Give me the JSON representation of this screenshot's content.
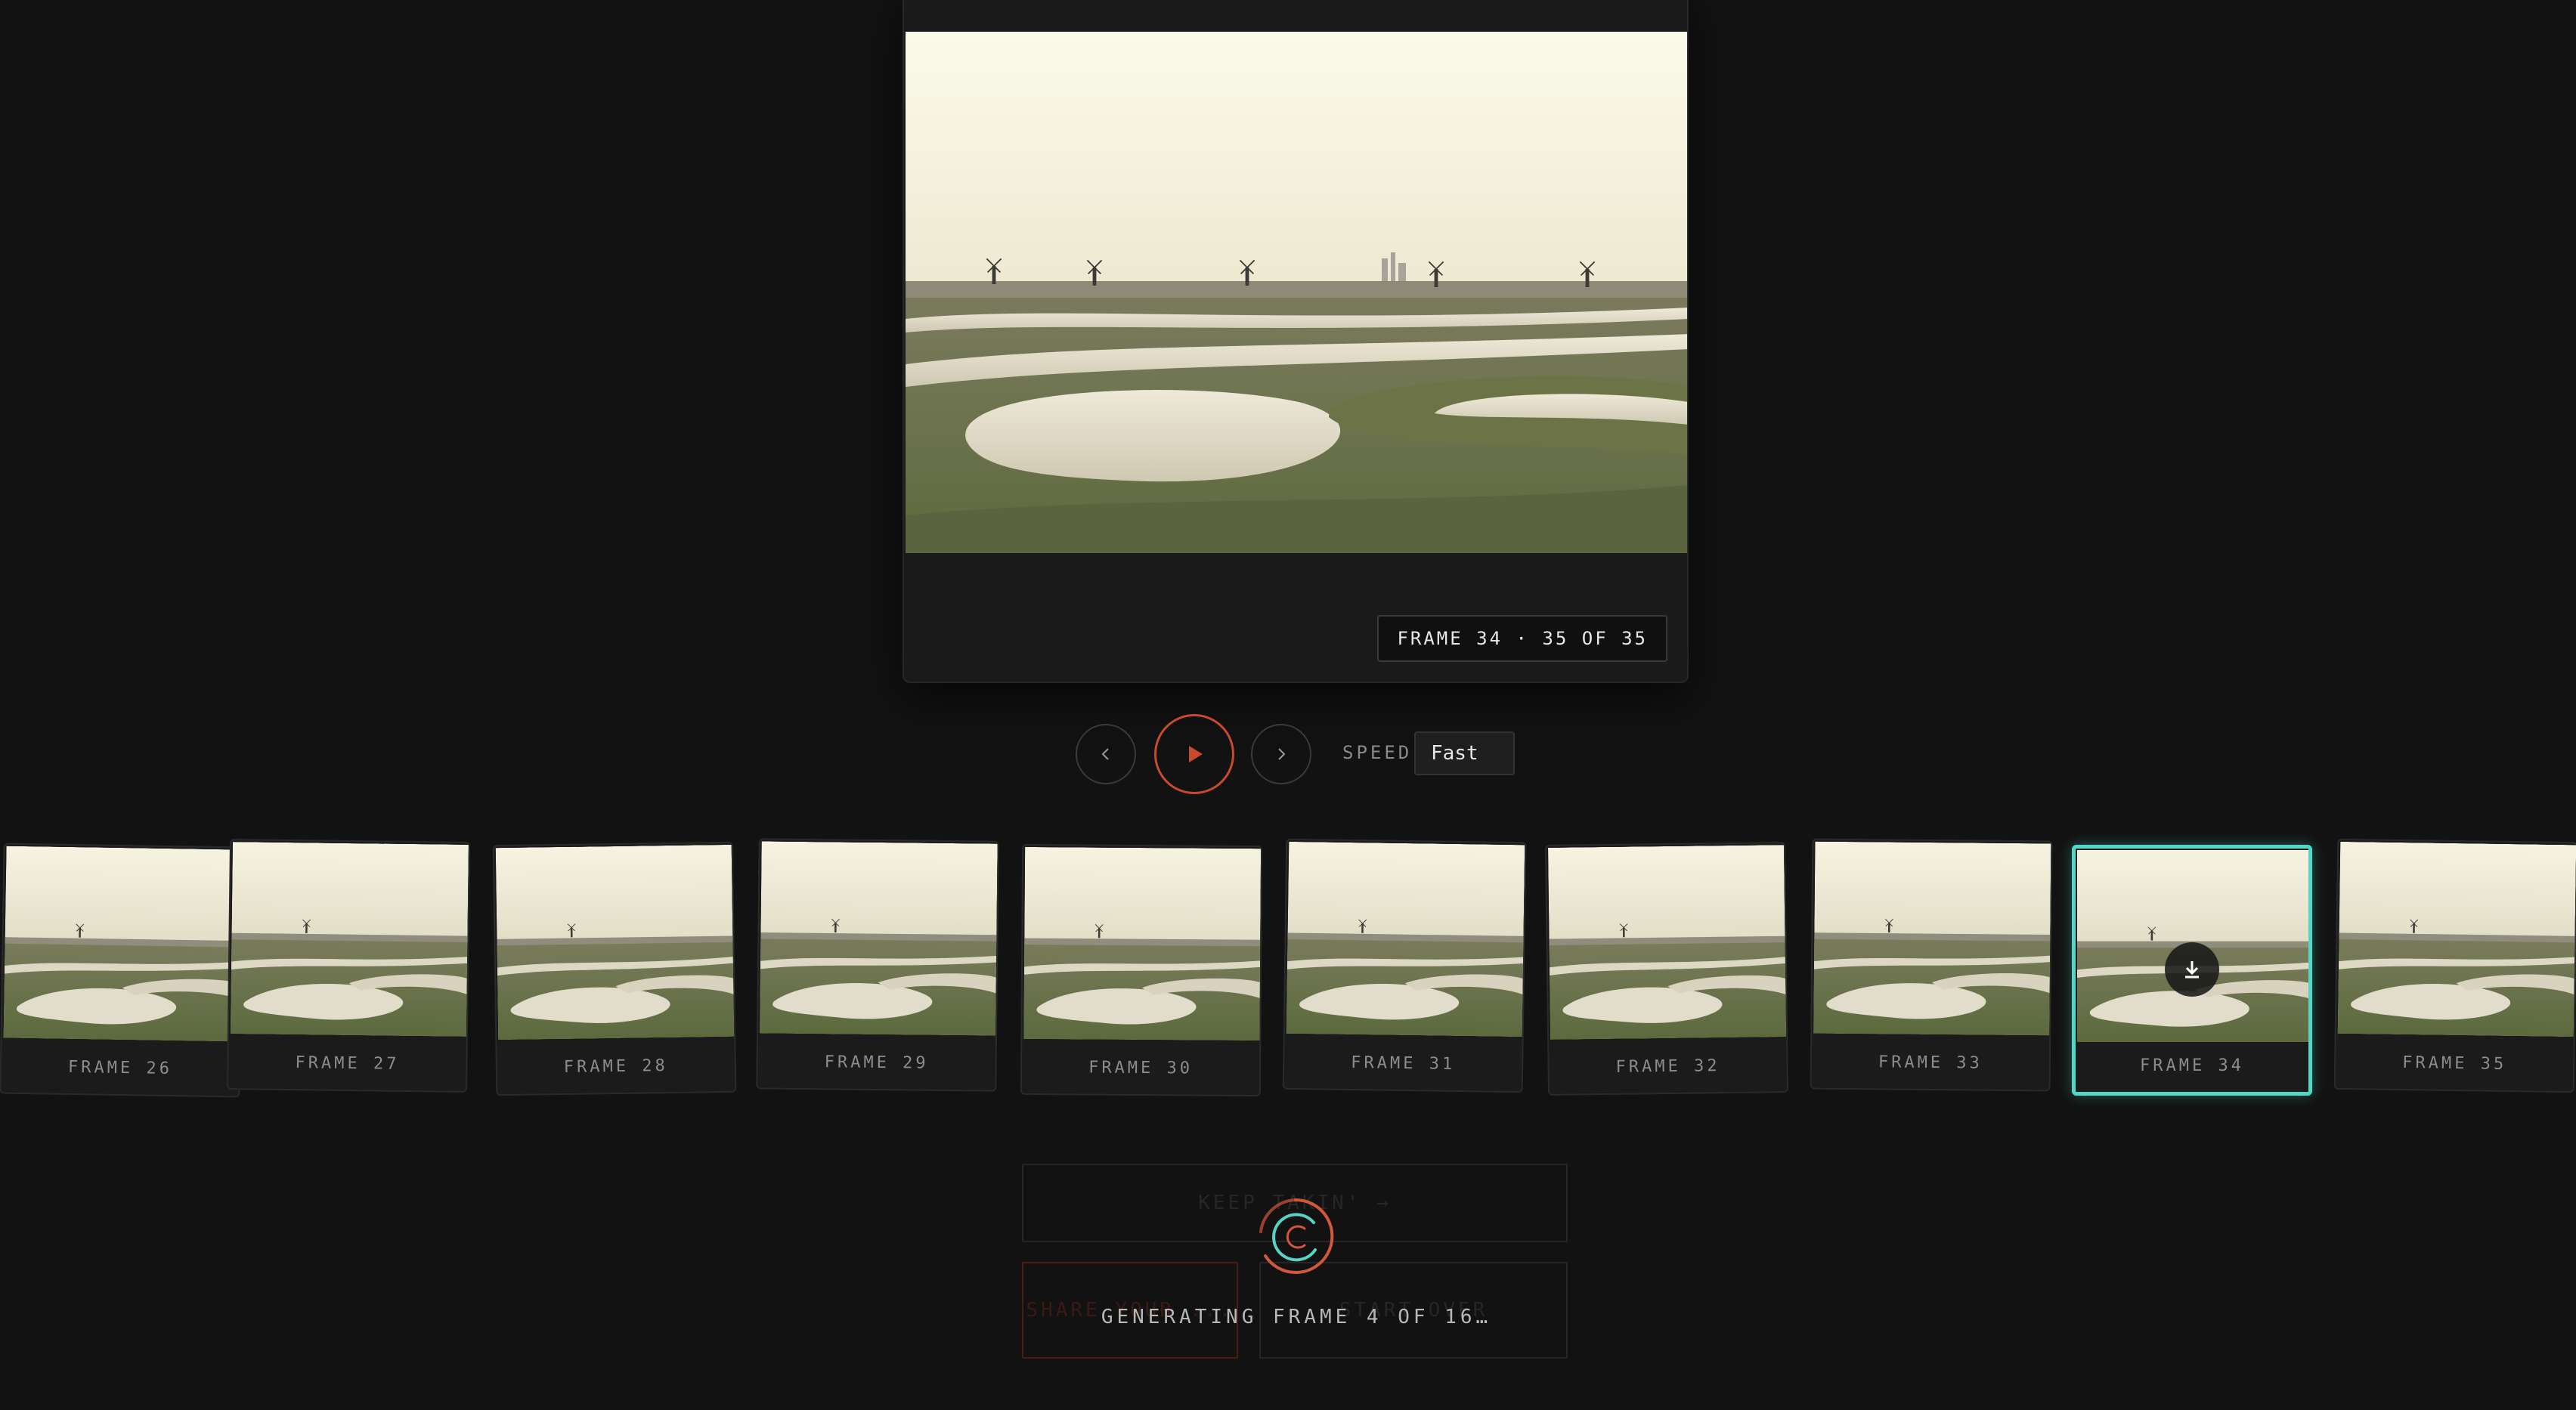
{
  "viewer": {
    "frame_badge": "FRAME 34 · 35 OF 35"
  },
  "controls": {
    "prev_icon": "chevron-left-icon",
    "play_icon": "play-icon",
    "next_icon": "chevron-right-icon",
    "speed_label": "SPEED",
    "speed_value": "Fast"
  },
  "filmstrip": {
    "frames": [
      {
        "label": "FRAME 26"
      },
      {
        "label": "FRAME 27"
      },
      {
        "label": "FRAME 28"
      },
      {
        "label": "FRAME 29"
      },
      {
        "label": "FRAME 30"
      },
      {
        "label": "FRAME 31"
      },
      {
        "label": "FRAME 32"
      },
      {
        "label": "FRAME 33"
      },
      {
        "label": "FRAME 34",
        "active": true
      },
      {
        "label": "FRAME 35"
      }
    ],
    "active_action_icon": "download-icon"
  },
  "actions": {
    "keep_label": "KEEP TAKIN' →",
    "share_label": "SHARE YOUR ...",
    "start_over_label": "START OVER"
  },
  "status": {
    "generating": "GENERATING FRAME 4 OF 16…"
  },
  "colors": {
    "accent_orange": "#c84a2c",
    "accent_teal": "#4fd8c8",
    "background": "#121212"
  }
}
